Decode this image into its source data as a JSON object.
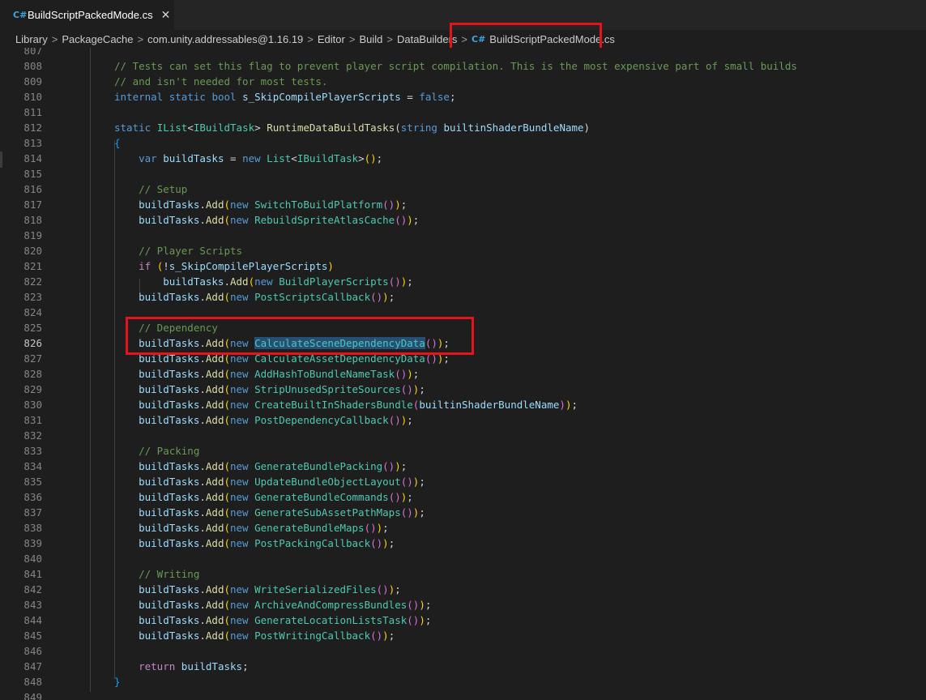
{
  "tab": {
    "icon": "csharp-file-icon",
    "icon_glyph": "C#",
    "title": "BuildScriptPackedMode.cs",
    "close": "✕"
  },
  "breadcrumb": {
    "items": [
      "Library",
      "PackageCache",
      "com.unity.addressables@1.16.19",
      "Editor",
      "Build",
      "DataBuilders"
    ],
    "current": "BuildScriptPackedMode.cs",
    "separator": ">"
  },
  "editor": {
    "current_line": 826,
    "lines": [
      {
        "n": "807",
        "tokens": []
      },
      {
        "n": "808",
        "tokens": [
          [
            "c",
            "// Tests can set this flag to prevent player script compilation. This is the most expensive part of small builds"
          ]
        ]
      },
      {
        "n": "809",
        "tokens": [
          [
            "c",
            "// and isn't needed for most tests."
          ]
        ]
      },
      {
        "n": "810",
        "tokens": [
          [
            "k",
            "internal"
          ],
          [
            "p",
            " "
          ],
          [
            "k",
            "static"
          ],
          [
            "p",
            " "
          ],
          [
            "k",
            "bool"
          ],
          [
            "p",
            " "
          ],
          [
            "v",
            "s_SkipCompilePlayerScripts"
          ],
          [
            "p",
            " = "
          ],
          [
            "k",
            "false"
          ],
          [
            "p",
            ";"
          ]
        ]
      },
      {
        "n": "811",
        "tokens": []
      },
      {
        "n": "812",
        "tokens": [
          [
            "k",
            "static"
          ],
          [
            "p",
            " "
          ],
          [
            "t",
            "IList"
          ],
          [
            "p",
            "<"
          ],
          [
            "t",
            "IBuildTask"
          ],
          [
            "p",
            "> "
          ],
          [
            "f",
            "RuntimeDataBuildTasks"
          ],
          [
            "p",
            "("
          ],
          [
            "k",
            "string"
          ],
          [
            "p",
            " "
          ],
          [
            "v",
            "builtinShaderBundleName"
          ],
          [
            "p",
            ")"
          ]
        ]
      },
      {
        "n": "813",
        "tokens": [
          [
            "b3",
            "{"
          ]
        ]
      },
      {
        "n": "814",
        "tokens": [
          [
            "k",
            "    var"
          ],
          [
            "p",
            " "
          ],
          [
            "v",
            "buildTasks"
          ],
          [
            "p",
            " = "
          ],
          [
            "k",
            "new"
          ],
          [
            "p",
            " "
          ],
          [
            "t",
            "List"
          ],
          [
            "p",
            "<"
          ],
          [
            "t",
            "IBuildTask"
          ],
          [
            "p",
            ">"
          ],
          [
            "b1",
            "()"
          ],
          [
            "p",
            ";"
          ]
        ]
      },
      {
        "n": "815",
        "tokens": []
      },
      {
        "n": "816",
        "tokens": [
          [
            "c",
            "    // Setup"
          ]
        ]
      },
      {
        "n": "817",
        "tokens": [
          [
            "v",
            "    buildTasks"
          ],
          [
            "p",
            "."
          ],
          [
            "f",
            "Add"
          ],
          [
            "b1",
            "("
          ],
          [
            "k",
            "new"
          ],
          [
            "p",
            " "
          ],
          [
            "t",
            "SwitchToBuildPlatform"
          ],
          [
            "b2",
            "()"
          ],
          [
            "b1",
            ")"
          ],
          [
            "p",
            ";"
          ]
        ]
      },
      {
        "n": "818",
        "tokens": [
          [
            "v",
            "    buildTasks"
          ],
          [
            "p",
            "."
          ],
          [
            "f",
            "Add"
          ],
          [
            "b1",
            "("
          ],
          [
            "k",
            "new"
          ],
          [
            "p",
            " "
          ],
          [
            "t",
            "RebuildSpriteAtlasCache"
          ],
          [
            "b2",
            "()"
          ],
          [
            "b1",
            ")"
          ],
          [
            "p",
            ";"
          ]
        ]
      },
      {
        "n": "819",
        "tokens": []
      },
      {
        "n": "820",
        "tokens": [
          [
            "c",
            "    // Player Scripts"
          ]
        ]
      },
      {
        "n": "821",
        "tokens": [
          [
            "kc",
            "    if"
          ],
          [
            "p",
            " "
          ],
          [
            "b1",
            "("
          ],
          [
            "p",
            "!"
          ],
          [
            "v",
            "s_SkipCompilePlayerScripts"
          ],
          [
            "b1",
            ")"
          ]
        ]
      },
      {
        "n": "822",
        "tokens": [
          [
            "v",
            "        buildTasks"
          ],
          [
            "p",
            "."
          ],
          [
            "f",
            "Add"
          ],
          [
            "b1",
            "("
          ],
          [
            "k",
            "new"
          ],
          [
            "p",
            " "
          ],
          [
            "t",
            "BuildPlayerScripts"
          ],
          [
            "b2",
            "()"
          ],
          [
            "b1",
            ")"
          ],
          [
            "p",
            ";"
          ]
        ]
      },
      {
        "n": "823",
        "tokens": [
          [
            "v",
            "    buildTasks"
          ],
          [
            "p",
            "."
          ],
          [
            "f",
            "Add"
          ],
          [
            "b1",
            "("
          ],
          [
            "k",
            "new"
          ],
          [
            "p",
            " "
          ],
          [
            "t",
            "PostScriptsCallback"
          ],
          [
            "b2",
            "()"
          ],
          [
            "b1",
            ")"
          ],
          [
            "p",
            ";"
          ]
        ]
      },
      {
        "n": "824",
        "tokens": []
      },
      {
        "n": "825",
        "tokens": [
          [
            "c",
            "    // Dependency"
          ]
        ]
      },
      {
        "n": "826",
        "tokens": [
          [
            "v",
            "    buildTasks"
          ],
          [
            "p",
            "."
          ],
          [
            "f",
            "Add"
          ],
          [
            "b1",
            "("
          ],
          [
            "k",
            "new"
          ],
          [
            "p",
            " "
          ],
          [
            "ts",
            "CalculateSceneDependencyData"
          ],
          [
            "b2",
            "()"
          ],
          [
            "b1",
            ")"
          ],
          [
            "p",
            ";"
          ]
        ]
      },
      {
        "n": "827",
        "tokens": [
          [
            "v",
            "    buildTasks"
          ],
          [
            "p",
            "."
          ],
          [
            "f",
            "Add"
          ],
          [
            "b1",
            "("
          ],
          [
            "k",
            "new"
          ],
          [
            "p",
            " "
          ],
          [
            "t",
            "CalculateAssetDependencyData"
          ],
          [
            "b2",
            "()"
          ],
          [
            "b1",
            ")"
          ],
          [
            "p",
            ";"
          ]
        ]
      },
      {
        "n": "828",
        "tokens": [
          [
            "v",
            "    buildTasks"
          ],
          [
            "p",
            "."
          ],
          [
            "f",
            "Add"
          ],
          [
            "b1",
            "("
          ],
          [
            "k",
            "new"
          ],
          [
            "p",
            " "
          ],
          [
            "t",
            "AddHashToBundleNameTask"
          ],
          [
            "b2",
            "()"
          ],
          [
            "b1",
            ")"
          ],
          [
            "p",
            ";"
          ]
        ]
      },
      {
        "n": "829",
        "tokens": [
          [
            "v",
            "    buildTasks"
          ],
          [
            "p",
            "."
          ],
          [
            "f",
            "Add"
          ],
          [
            "b1",
            "("
          ],
          [
            "k",
            "new"
          ],
          [
            "p",
            " "
          ],
          [
            "t",
            "StripUnusedSpriteSources"
          ],
          [
            "b2",
            "()"
          ],
          [
            "b1",
            ")"
          ],
          [
            "p",
            ";"
          ]
        ]
      },
      {
        "n": "830",
        "tokens": [
          [
            "v",
            "    buildTasks"
          ],
          [
            "p",
            "."
          ],
          [
            "f",
            "Add"
          ],
          [
            "b1",
            "("
          ],
          [
            "k",
            "new"
          ],
          [
            "p",
            " "
          ],
          [
            "t",
            "CreateBuiltInShadersBundle"
          ],
          [
            "b2",
            "("
          ],
          [
            "v",
            "builtinShaderBundleName"
          ],
          [
            "b2",
            ")"
          ],
          [
            "b1",
            ")"
          ],
          [
            "p",
            ";"
          ]
        ]
      },
      {
        "n": "831",
        "tokens": [
          [
            "v",
            "    buildTasks"
          ],
          [
            "p",
            "."
          ],
          [
            "f",
            "Add"
          ],
          [
            "b1",
            "("
          ],
          [
            "k",
            "new"
          ],
          [
            "p",
            " "
          ],
          [
            "t",
            "PostDependencyCallback"
          ],
          [
            "b2",
            "()"
          ],
          [
            "b1",
            ")"
          ],
          [
            "p",
            ";"
          ]
        ]
      },
      {
        "n": "832",
        "tokens": []
      },
      {
        "n": "833",
        "tokens": [
          [
            "c",
            "    // Packing"
          ]
        ]
      },
      {
        "n": "834",
        "tokens": [
          [
            "v",
            "    buildTasks"
          ],
          [
            "p",
            "."
          ],
          [
            "f",
            "Add"
          ],
          [
            "b1",
            "("
          ],
          [
            "k",
            "new"
          ],
          [
            "p",
            " "
          ],
          [
            "t",
            "GenerateBundlePacking"
          ],
          [
            "b2",
            "()"
          ],
          [
            "b1",
            ")"
          ],
          [
            "p",
            ";"
          ]
        ]
      },
      {
        "n": "835",
        "tokens": [
          [
            "v",
            "    buildTasks"
          ],
          [
            "p",
            "."
          ],
          [
            "f",
            "Add"
          ],
          [
            "b1",
            "("
          ],
          [
            "k",
            "new"
          ],
          [
            "p",
            " "
          ],
          [
            "t",
            "UpdateBundleObjectLayout"
          ],
          [
            "b2",
            "()"
          ],
          [
            "b1",
            ")"
          ],
          [
            "p",
            ";"
          ]
        ]
      },
      {
        "n": "836",
        "tokens": [
          [
            "v",
            "    buildTasks"
          ],
          [
            "p",
            "."
          ],
          [
            "f",
            "Add"
          ],
          [
            "b1",
            "("
          ],
          [
            "k",
            "new"
          ],
          [
            "p",
            " "
          ],
          [
            "t",
            "GenerateBundleCommands"
          ],
          [
            "b2",
            "()"
          ],
          [
            "b1",
            ")"
          ],
          [
            "p",
            ";"
          ]
        ]
      },
      {
        "n": "837",
        "tokens": [
          [
            "v",
            "    buildTasks"
          ],
          [
            "p",
            "."
          ],
          [
            "f",
            "Add"
          ],
          [
            "b1",
            "("
          ],
          [
            "k",
            "new"
          ],
          [
            "p",
            " "
          ],
          [
            "t",
            "GenerateSubAssetPathMaps"
          ],
          [
            "b2",
            "()"
          ],
          [
            "b1",
            ")"
          ],
          [
            "p",
            ";"
          ]
        ]
      },
      {
        "n": "838",
        "tokens": [
          [
            "v",
            "    buildTasks"
          ],
          [
            "p",
            "."
          ],
          [
            "f",
            "Add"
          ],
          [
            "b1",
            "("
          ],
          [
            "k",
            "new"
          ],
          [
            "p",
            " "
          ],
          [
            "t",
            "GenerateBundleMaps"
          ],
          [
            "b2",
            "()"
          ],
          [
            "b1",
            ")"
          ],
          [
            "p",
            ";"
          ]
        ]
      },
      {
        "n": "839",
        "tokens": [
          [
            "v",
            "    buildTasks"
          ],
          [
            "p",
            "."
          ],
          [
            "f",
            "Add"
          ],
          [
            "b1",
            "("
          ],
          [
            "k",
            "new"
          ],
          [
            "p",
            " "
          ],
          [
            "t",
            "PostPackingCallback"
          ],
          [
            "b2",
            "()"
          ],
          [
            "b1",
            ")"
          ],
          [
            "p",
            ";"
          ]
        ]
      },
      {
        "n": "840",
        "tokens": []
      },
      {
        "n": "841",
        "tokens": [
          [
            "c",
            "    // Writing"
          ]
        ]
      },
      {
        "n": "842",
        "tokens": [
          [
            "v",
            "    buildTasks"
          ],
          [
            "p",
            "."
          ],
          [
            "f",
            "Add"
          ],
          [
            "b1",
            "("
          ],
          [
            "k",
            "new"
          ],
          [
            "p",
            " "
          ],
          [
            "t",
            "WriteSerializedFiles"
          ],
          [
            "b2",
            "()"
          ],
          [
            "b1",
            ")"
          ],
          [
            "p",
            ";"
          ]
        ]
      },
      {
        "n": "843",
        "tokens": [
          [
            "v",
            "    buildTasks"
          ],
          [
            "p",
            "."
          ],
          [
            "f",
            "Add"
          ],
          [
            "b1",
            "("
          ],
          [
            "k",
            "new"
          ],
          [
            "p",
            " "
          ],
          [
            "t",
            "ArchiveAndCompressBundles"
          ],
          [
            "b2",
            "()"
          ],
          [
            "b1",
            ")"
          ],
          [
            "p",
            ";"
          ]
        ]
      },
      {
        "n": "844",
        "tokens": [
          [
            "v",
            "    buildTasks"
          ],
          [
            "p",
            "."
          ],
          [
            "f",
            "Add"
          ],
          [
            "b1",
            "("
          ],
          [
            "k",
            "new"
          ],
          [
            "p",
            " "
          ],
          [
            "t",
            "GenerateLocationListsTask"
          ],
          [
            "b2",
            "()"
          ],
          [
            "b1",
            ")"
          ],
          [
            "p",
            ";"
          ]
        ]
      },
      {
        "n": "845",
        "tokens": [
          [
            "v",
            "    buildTasks"
          ],
          [
            "p",
            "."
          ],
          [
            "f",
            "Add"
          ],
          [
            "b1",
            "("
          ],
          [
            "k",
            "new"
          ],
          [
            "p",
            " "
          ],
          [
            "t",
            "PostWritingCallback"
          ],
          [
            "b2",
            "()"
          ],
          [
            "b1",
            ")"
          ],
          [
            "p",
            ";"
          ]
        ]
      },
      {
        "n": "846",
        "tokens": []
      },
      {
        "n": "847",
        "tokens": [
          [
            "kc",
            "    return"
          ],
          [
            "p",
            " "
          ],
          [
            "v",
            "buildTasks"
          ],
          [
            "p",
            ";"
          ]
        ]
      },
      {
        "n": "848",
        "tokens": [
          [
            "b3",
            "}"
          ]
        ]
      },
      {
        "n": "849",
        "tokens": []
      }
    ]
  },
  "colors": {
    "c": "#6a9955",
    "k": "#569cd6",
    "kc": "#c586c0",
    "v": "#9cdcfe",
    "f": "#dcdcaa",
    "t": "#4ec9b0",
    "ts": "#4ec9b0",
    "p": "#d4d4d4",
    "b1": "#ffd700",
    "b2": "#da70d6",
    "b3": "#179fff",
    "annotation": "#e8121a"
  }
}
